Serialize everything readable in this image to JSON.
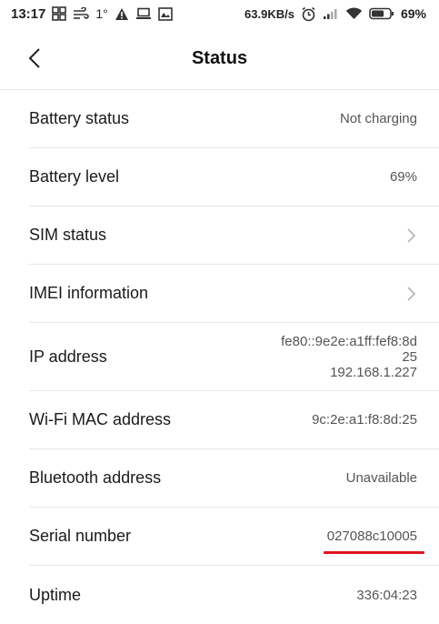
{
  "status_bar": {
    "time": "13:17",
    "temperature": "1°",
    "net_speed": "63.9KB/s",
    "battery_percent": "69%",
    "battery_level_fraction": 0.69
  },
  "header": {
    "title": "Status"
  },
  "rows": [
    {
      "label": "Battery status",
      "value": "Not charging"
    },
    {
      "label": "Battery level",
      "value": "69%"
    },
    {
      "label": "SIM status"
    },
    {
      "label": "IMEI information"
    },
    {
      "label": "IP address",
      "value_lines": [
        "fe80::9e2e:a1ff:fef8:8d",
        "25",
        "192.168.1.227"
      ]
    },
    {
      "label": "Wi-Fi MAC address",
      "value": "9c:2e:a1:f8:8d:25"
    },
    {
      "label": "Bluetooth address",
      "value": "Unavailable"
    },
    {
      "label": "Serial number",
      "value": "027088c10005"
    },
    {
      "label": "Uptime",
      "value": "336:04:23"
    }
  ],
  "colors": {
    "highlight_underline": "#e0141e",
    "divider": "#e6e6e6"
  }
}
